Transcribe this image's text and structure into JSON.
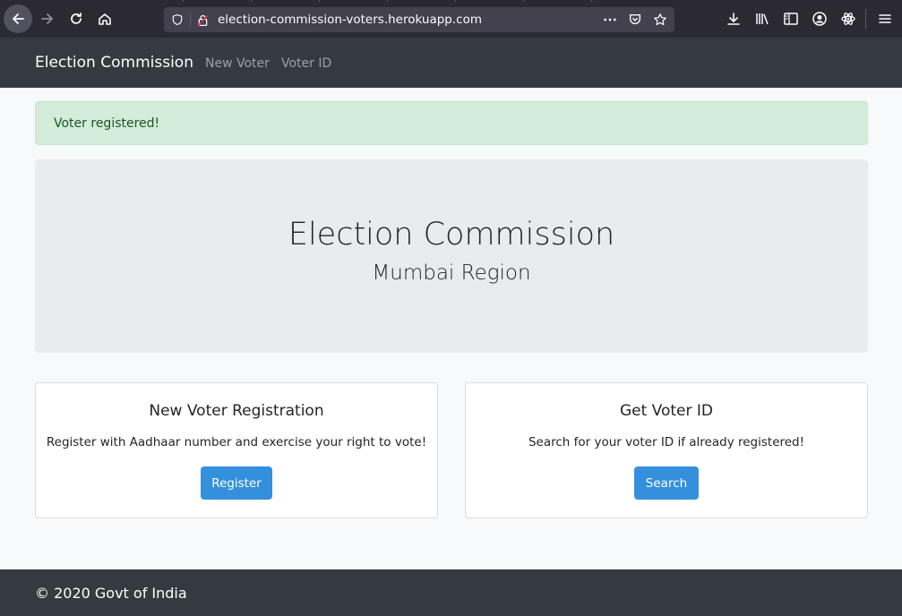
{
  "browser": {
    "url": "election-commission-voters.herokuapp.com",
    "icons": [
      "back-icon",
      "forward-icon",
      "reload-icon",
      "home-icon",
      "shield-icon",
      "insecure-lock-icon",
      "more-icon",
      "pocket-icon",
      "star-icon",
      "download-icon",
      "library-icon",
      "sidebar-icon",
      "account-icon",
      "extension-icon",
      "menu-icon"
    ]
  },
  "navbar": {
    "brand": "Election Commission",
    "links": [
      "New Voter",
      "Voter ID"
    ]
  },
  "alert": {
    "message": "Voter registered!"
  },
  "jumbotron": {
    "title": "Election Commission",
    "subtitle": "Mumbai Region"
  },
  "cards": [
    {
      "title": "New Voter Registration",
      "text": "Register with Aadhaar number and exercise your right to vote!",
      "button": "Register"
    },
    {
      "title": "Get Voter ID",
      "text": "Search for your voter ID if already registered!",
      "button": "Search"
    }
  ],
  "footer": {
    "text": "© 2020 Govt of India"
  },
  "colors": {
    "navbar": "#343a40",
    "alert_bg": "#d4edda",
    "alert_text": "#155724",
    "jumbotron": "#e9ecef",
    "button": "#3490dc"
  }
}
